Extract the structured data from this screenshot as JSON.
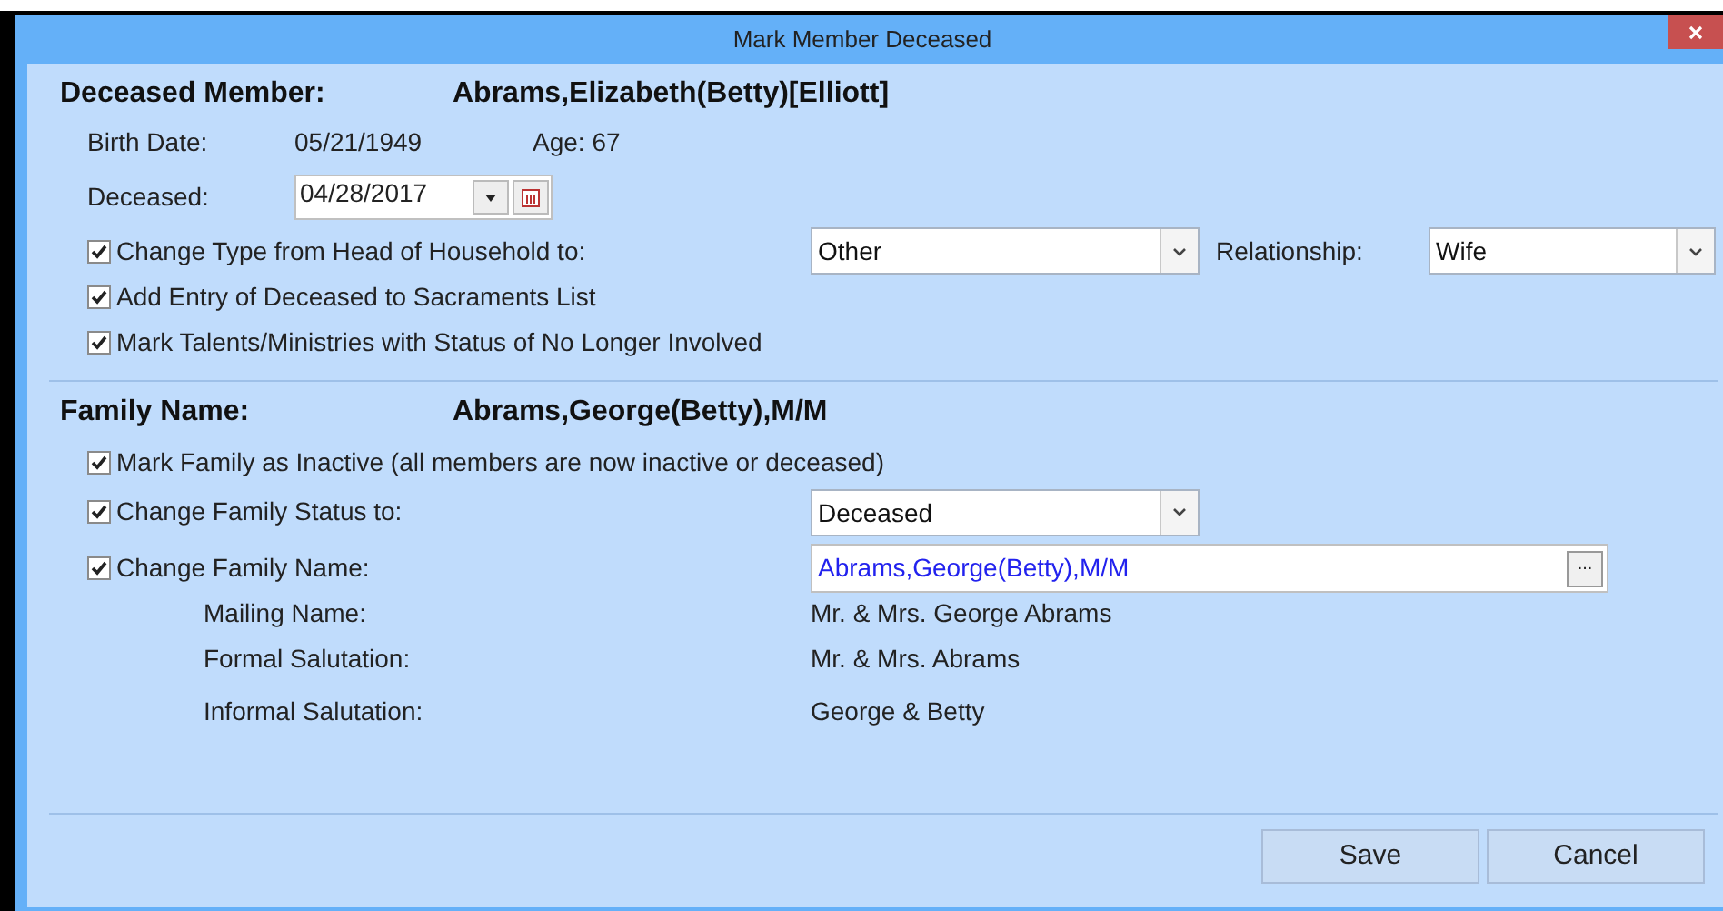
{
  "window": {
    "title": "Mark Member Deceased"
  },
  "member": {
    "heading_label": "Deceased Member:",
    "name": "Abrams,Elizabeth(Betty)[Elliott]",
    "birth_date_label": "Birth Date:",
    "birth_date": "05/21/1949",
    "age": "Age: 67",
    "deceased_label": "Deceased:",
    "deceased_date": "04/28/2017"
  },
  "member_options": [
    {
      "kind": "dropdowns",
      "label": "Change Type from Head of Household to:",
      "checked": true,
      "value": "Other",
      "relationship_label": "Relationship:",
      "relationship": "Wife"
    },
    {
      "kind": "plain",
      "label": "Add Entry of Deceased to Sacraments List",
      "checked": true
    },
    {
      "kind": "plain",
      "label": "Mark Talents/Ministries with Status of No Longer Involved",
      "checked": true
    }
  ],
  "family": {
    "heading_label": "Family Name:",
    "name": "Abrams,George(Betty),M/M"
  },
  "family_options": [
    {
      "kind": "plain",
      "label": "Mark Family as Inactive (all members are now inactive or deceased)",
      "checked": true
    },
    {
      "kind": "dropdown",
      "label": "Change Family Status to:",
      "checked": true,
      "value": "Deceased"
    },
    {
      "kind": "name",
      "label": "Change Family Name:",
      "checked": true,
      "value": "Abrams,George(Betty),M/M",
      "button": "..."
    }
  ],
  "name_details": [
    {
      "label": "Mailing Name:",
      "value": "Mr. & Mrs. George Abrams"
    },
    {
      "label": "Formal Salutation:",
      "value": "Mr. & Mrs. Abrams"
    },
    {
      "label": "Informal Salutation:",
      "value": "George & Betty"
    }
  ],
  "buttons": [
    {
      "label": "Save"
    },
    {
      "label": "Cancel"
    }
  ]
}
